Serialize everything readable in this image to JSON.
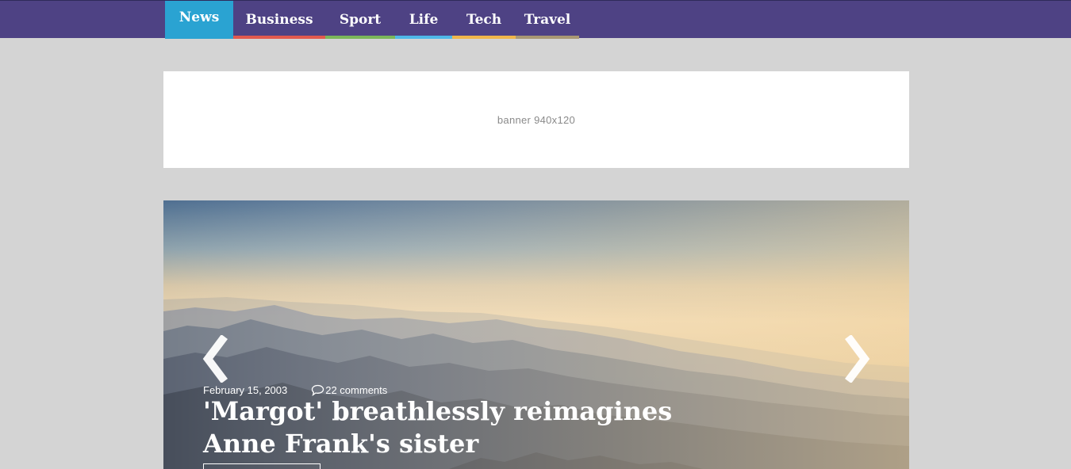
{
  "nav": {
    "items": [
      {
        "label": "News",
        "color": "#2aa3d2",
        "active": true
      },
      {
        "label": "Business",
        "color": "#e25a4e"
      },
      {
        "label": "Sport",
        "color": "#7bb75a"
      },
      {
        "label": "Life",
        "color": "#4fb8e8"
      },
      {
        "label": "Tech",
        "color": "#f0b64a"
      },
      {
        "label": "Travel",
        "color": "#a99874"
      }
    ],
    "bar_color": "#4e4284"
  },
  "banner": {
    "text": "banner 940x120"
  },
  "hero": {
    "date": "February 15, 2003",
    "comments": "22 comments",
    "title": "'Margot' breathlessly reimagines Anne Frank's sister",
    "icons": {
      "prev": "chevron-left-icon",
      "next": "chevron-right-icon",
      "comment": "speech-bubble-icon"
    }
  }
}
